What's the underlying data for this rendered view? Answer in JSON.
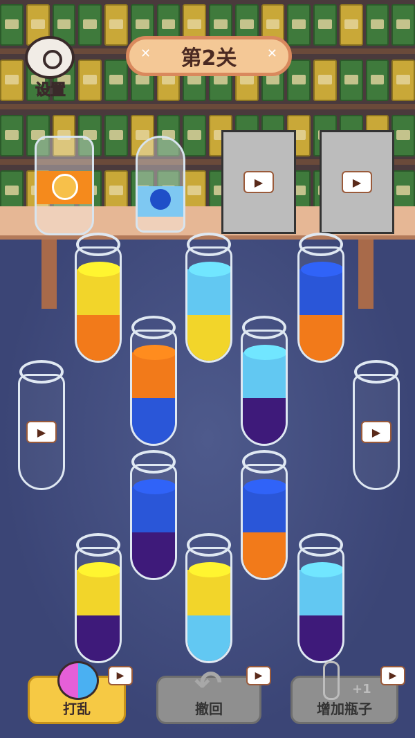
{
  "level": {
    "title": "第2关"
  },
  "settings": {
    "label": "设置"
  },
  "buttons": {
    "shuffle": "打乱",
    "undo": "撤回",
    "add_bottle": "增加瓶子",
    "add_bottle_badge": "+1"
  },
  "colors": {
    "yellow": "#f2d52a",
    "orange": "#f27a1a",
    "lightblue": "#62c8f2",
    "blue": "#2a56d8",
    "purple": "#3e1a7a"
  },
  "tubes": [
    {
      "name": "tube-1",
      "layers": [
        "orange",
        "yellow"
      ]
    },
    {
      "name": "tube-2",
      "layers": [
        "yellow",
        "lightblue"
      ]
    },
    {
      "name": "tube-3",
      "layers": [
        "blue",
        "orange"
      ]
    },
    {
      "name": "tube-4",
      "layers": [
        "orange",
        "blue"
      ]
    },
    {
      "name": "tube-5",
      "layers": [
        "purple",
        "lightblue"
      ]
    },
    {
      "name": "tube-6",
      "layers": [
        "purple",
        "blue"
      ]
    },
    {
      "name": "tube-7",
      "layers": [
        "orange",
        "blue"
      ]
    },
    {
      "name": "tube-8",
      "layers": [
        "purple",
        "yellow"
      ]
    },
    {
      "name": "tube-9",
      "layers": [
        "lightblue",
        "yellow"
      ]
    },
    {
      "name": "tube-10",
      "layers": [
        "purple",
        "lightblue"
      ]
    },
    {
      "name": "tube-locked-left",
      "layers": [],
      "locked": true
    },
    {
      "name": "tube-locked-right",
      "layers": [],
      "locked": true
    }
  ],
  "video_icon": "video-camera-icon"
}
